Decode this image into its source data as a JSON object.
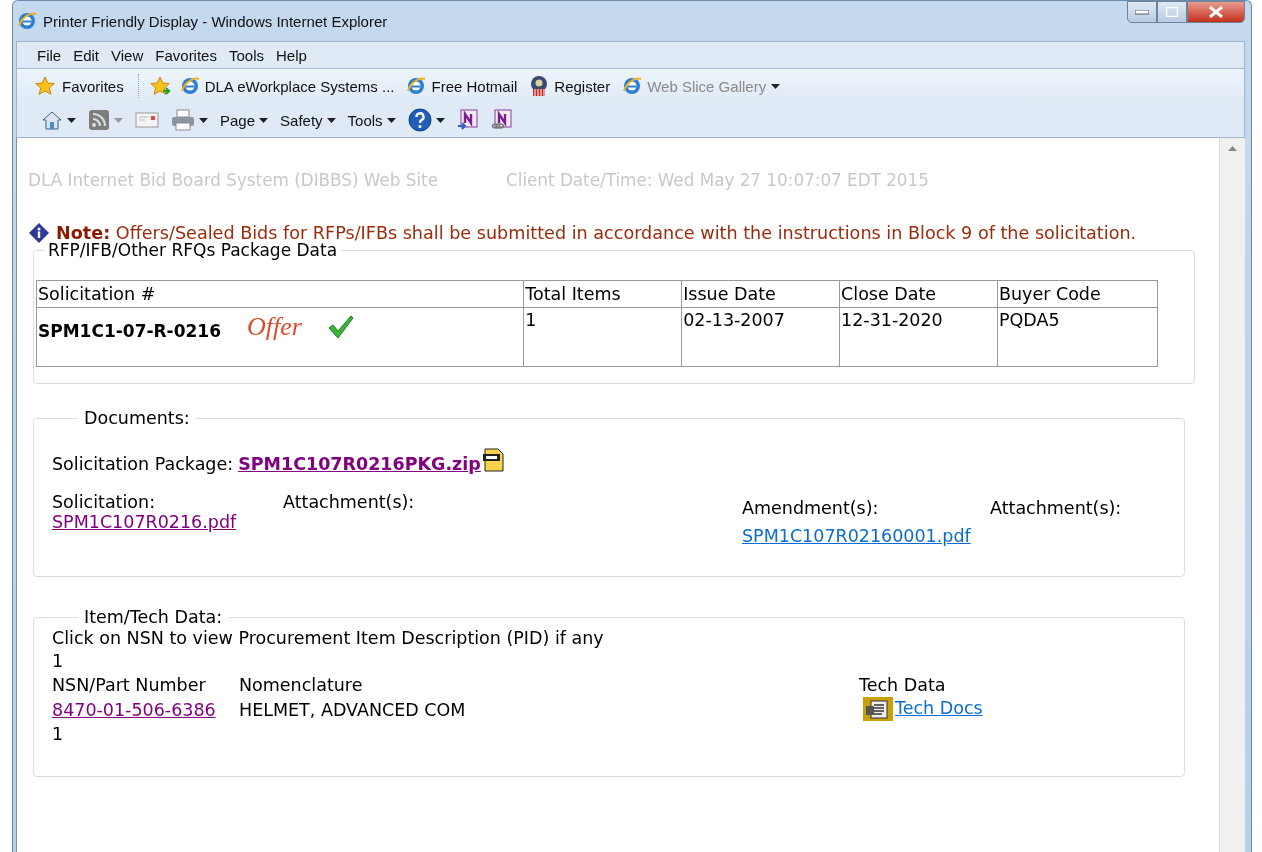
{
  "window": {
    "title": "Printer Friendly Display - Windows Internet Explorer"
  },
  "menu": [
    "File",
    "Edit",
    "View",
    "Favorites",
    "Tools",
    "Help"
  ],
  "favorites_bar": [
    {
      "label": "Favorites",
      "kind": "favorites",
      "disabled": false
    },
    {
      "label": "DLA eWorkplace Systems ...",
      "kind": "browser",
      "disabled": false
    },
    {
      "label": "Free Hotmail",
      "kind": "browser",
      "disabled": false
    },
    {
      "label": "Register",
      "kind": "seal",
      "disabled": false
    },
    {
      "label": "Web Slice Gallery",
      "kind": "gallery",
      "disabled": true
    }
  ],
  "command_bar": [
    {
      "kind": "home"
    },
    {
      "kind": "feed",
      "disabled": true
    },
    {
      "kind": "mail"
    },
    {
      "kind": "print"
    },
    {
      "kind": "menu",
      "label": "Page"
    },
    {
      "kind": "menu",
      "label": "Safety"
    },
    {
      "kind": "menu",
      "label": "Tools"
    },
    {
      "kind": "help"
    },
    {
      "kind": "note"
    },
    {
      "kind": "note-link"
    }
  ],
  "page": {
    "site_title": "DLA Internet Bid Board System (DIBBS) Web Site",
    "client_time": "Client Date/Time: Wed May 27 10:07:07 EDT 2015",
    "note": "**Note:** Offers/Sealed Bids for RFPs/IFBs shall be submitted in accordance with the instructions in Block 9 of the solicitation.",
    "package": {
      "legend": "RFP/IFB/Other RFQs Package Data",
      "columns": [
        "Solicitation #",
        "Total Items",
        "Issue Date",
        "Close Date",
        "Buyer Code"
      ],
      "row": {
        "solicitation": "SPM1C1-07-R-0216",
        "offer": "Offer",
        "offer_checked": true,
        "total_items": "1",
        "issue_date": "02-13-2007",
        "close_date": "12-31-2020",
        "buyer_code": "PQDA5"
      }
    },
    "documents": {
      "legend": "Documents:",
      "package_label": "Solicitation Package:",
      "package_link": {
        "text": "SPM1C107R0216PKG.zip",
        "visited": true
      },
      "solicitation_label": "Solicitation:",
      "solicitation_links": [
        {
          "text": "SPM1C107R0216.pdf",
          "visited": true
        }
      ],
      "attachments_label": "Attachment(s):",
      "amendments_label": "Amendment(s):",
      "amendment_links": [
        {
          "text": "SPM1C107R02160001.pdf",
          "visited": false
        }
      ],
      "amendment_attachments_label": "Attachment(s):"
    },
    "items": {
      "legend": "Item/Tech Data:",
      "instruction": "Click on NSN to view Procurement Item Description (PID) if any",
      "count": "1",
      "columns": [
        "NSN/Part Number",
        "Nomenclature",
        "Tech Data"
      ],
      "rows": [
        {
          "nsn": {
            "text": "8470-01-506-6386",
            "visited": true
          },
          "nomenclature": "HELMET, ADVANCED COM",
          "tech_link": {
            "text": "Tech Docs",
            "visited": false
          }
        }
      ],
      "footer_count": "1"
    }
  }
}
